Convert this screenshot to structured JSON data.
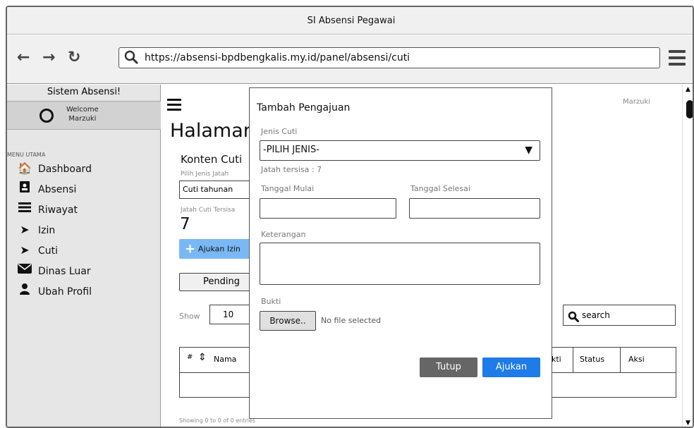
{
  "window": {
    "title": "SI Absensi Pegawai"
  },
  "browser": {
    "url": "https://absensi-bpdbengkalis.my.id/panel/absensi/cuti",
    "back_icon": "arrow-left-icon",
    "forward_icon": "arrow-right-icon",
    "reload_icon": "reload-icon"
  },
  "sidebar": {
    "title": "Sistem Absensi!",
    "welcome": "Welcome",
    "user": "Marzuki",
    "menu_label": "MENU UTAMA",
    "items": [
      {
        "label": "Dashboard",
        "icon": "home-icon"
      },
      {
        "label": "Absensi",
        "icon": "address-book-icon"
      },
      {
        "label": "Riwayat",
        "icon": "list-icon"
      },
      {
        "label": "Izin",
        "icon": "sign-in-icon"
      },
      {
        "label": "Cuti",
        "icon": "sign-in-icon"
      },
      {
        "label": "Dinas Luar",
        "icon": "envelope-icon"
      },
      {
        "label": "Ubah Profil",
        "icon": "user-icon"
      }
    ]
  },
  "header": {
    "user": "Marzuki"
  },
  "page": {
    "title": "Halaman",
    "card_title": "Konten Cuti",
    "pilih_label": "Pilih Jenis Jatah",
    "pilih_value": "Cuti tahunan",
    "jatah_label": "Jatah Cuti Tersisa",
    "jatah_value": "7",
    "ajukan_btn": "Ajukan Izin",
    "tab_pending": "Pending",
    "show_label": "Show",
    "show_value": "10",
    "search_placeholder": "search",
    "table": {
      "headers": [
        "#",
        "Nama",
        "kti",
        "Status",
        "Aksi"
      ]
    },
    "showing": "Showing 0 to 0 of 0 entries"
  },
  "modal": {
    "title": "Tambah Pengajuan",
    "jenis_label": "Jenis Cuti",
    "jenis_value": "-PILIH JENIS-",
    "jatah_info": "Jatah tersisa : 7",
    "mulai_label": "Tanggal Mulai",
    "selesai_label": "Tanggal Selesai",
    "keterangan_label": "Keterangan",
    "bukti_label": "Bukti",
    "browse_btn": "Browse..",
    "no_file": "No file selected",
    "tutup_btn": "Tutup",
    "ajukan_btn": "Ajukan"
  },
  "colors": {
    "primary": "#1e7be8",
    "dark_btn": "#666666",
    "info_btn": "#7ab8f5"
  }
}
